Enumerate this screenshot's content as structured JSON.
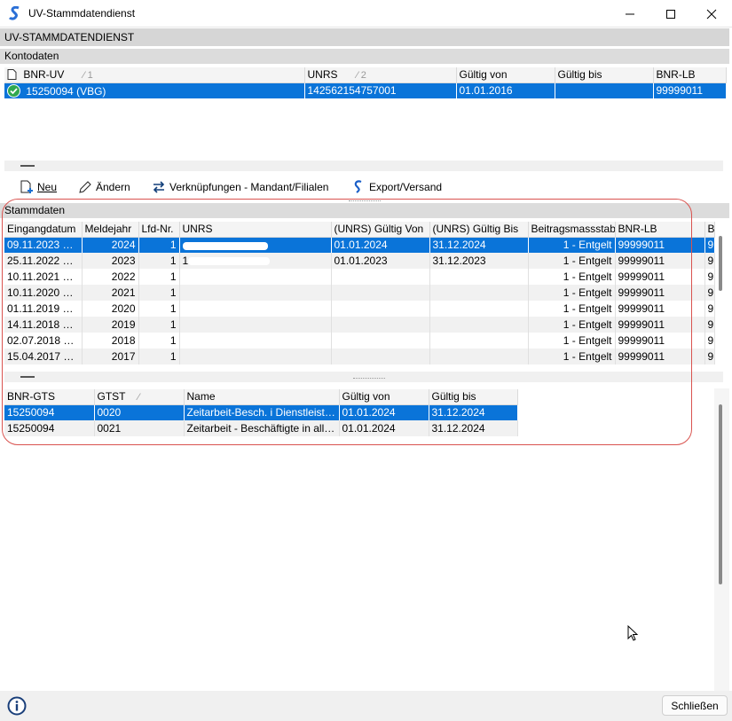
{
  "window": {
    "title": "UV-Stammdatendienst"
  },
  "header": {
    "title": "UV-STAMMDATENDIENST"
  },
  "kontodaten": {
    "label": "Kontodaten",
    "columns": [
      "BNR-UV",
      "UNRS",
      "Gültig von",
      "Gültig bis",
      "BNR-LB"
    ],
    "sort_hints": [
      "1",
      "2"
    ],
    "rows": [
      {
        "bnr_uv": "15250094 (VBG)",
        "unrs": "142562154757001",
        "gueltig_von": "01.01.2016",
        "gueltig_bis": "",
        "bnr_lb": "99999011",
        "status": "check-icon"
      }
    ]
  },
  "toolbar": {
    "new_label": "Neu",
    "edit_label": "Ändern",
    "links_label": "Verknüpfungen - Mandant/Filialen",
    "export_label": "Export/Versand"
  },
  "stammdaten": {
    "label": "Stammdaten",
    "columns": [
      "Eingangdatum",
      "Meldejahr",
      "Lfd-Nr.",
      "UNRS",
      "(UNRS) Gültig Von",
      "(UNRS) Gültig Bis",
      "Beitragsmassstab",
      "BNR-LB",
      "B"
    ],
    "rows": [
      {
        "eingang": "09.11.2023 10:...",
        "jahr": "2024",
        "lfd": "1",
        "unrs": "",
        "von": "01.01.2024",
        "bis": "31.12.2024",
        "massstab": "1 - Entgelt",
        "bnr_lb": "99999011",
        "b": "9"
      },
      {
        "eingang": "25.11.2022 15:...",
        "jahr": "2023",
        "lfd": "1",
        "unrs": "1",
        "von": "01.01.2023",
        "bis": "31.12.2023",
        "massstab": "1 - Entgelt",
        "bnr_lb": "99999011",
        "b": "9"
      },
      {
        "eingang": "10.11.2021 15:...",
        "jahr": "2022",
        "lfd": "1",
        "unrs": "",
        "von": "",
        "bis": "",
        "massstab": "1 - Entgelt",
        "bnr_lb": "99999011",
        "b": "9"
      },
      {
        "eingang": "10.11.2020 15:...",
        "jahr": "2021",
        "lfd": "1",
        "unrs": "",
        "von": "",
        "bis": "",
        "massstab": "1 - Entgelt",
        "bnr_lb": "99999011",
        "b": "9"
      },
      {
        "eingang": "01.11.2019 15:...",
        "jahr": "2020",
        "lfd": "1",
        "unrs": "",
        "von": "",
        "bis": "",
        "massstab": "1 - Entgelt",
        "bnr_lb": "99999011",
        "b": "9"
      },
      {
        "eingang": "14.11.2018 17:...",
        "jahr": "2019",
        "lfd": "1",
        "unrs": "",
        "von": "",
        "bis": "",
        "massstab": "1 - Entgelt",
        "bnr_lb": "99999011",
        "b": "9"
      },
      {
        "eingang": "02.07.2018 10:...",
        "jahr": "2018",
        "lfd": "1",
        "unrs": "",
        "von": "",
        "bis": "",
        "massstab": "1 - Entgelt",
        "bnr_lb": "99999011",
        "b": "9"
      },
      {
        "eingang": "15.04.2017 12:...",
        "jahr": "2017",
        "lfd": "1",
        "unrs": "",
        "von": "",
        "bis": "",
        "massstab": "1 - Entgelt",
        "bnr_lb": "99999011",
        "b": "9"
      }
    ]
  },
  "gts": {
    "columns": [
      "BNR-GTS",
      "GTST",
      "Name",
      "Gültig von",
      "Gültig bis"
    ],
    "rows": [
      {
        "bnr": "15250094",
        "gtst": "0020",
        "name": "Zeitarbeit-Besch. i Dienstleistu...",
        "von": "01.01.2024",
        "bis": "31.12.2024"
      },
      {
        "bnr": "15250094",
        "gtst": "0021",
        "name": "Zeitarbeit - Beschäftigte in alle...",
        "von": "01.01.2024",
        "bis": "31.12.2024"
      }
    ]
  },
  "footer": {
    "close_label": "Schließen",
    "info_icon": "info-icon"
  },
  "colors": {
    "selection": "#0a74d9",
    "highlight": "#d9534f",
    "section": "#dcdcdc"
  }
}
